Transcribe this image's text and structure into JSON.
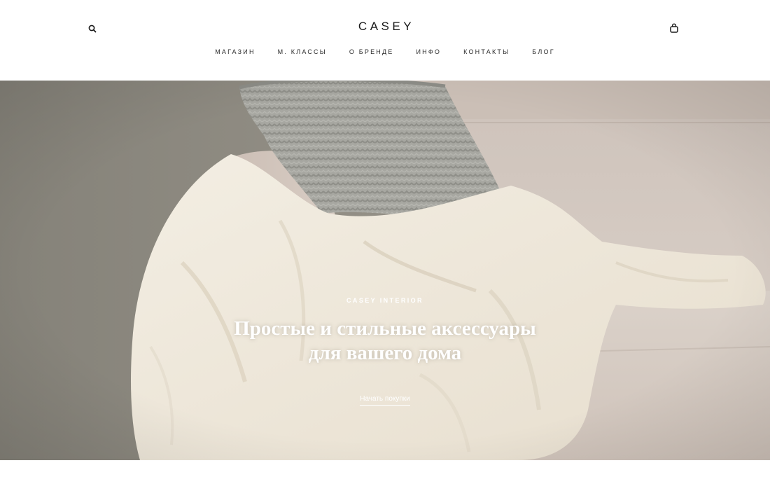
{
  "header": {
    "logo": "CASEY",
    "search_icon": "search-icon",
    "cart_icon": "shopping-bag-icon"
  },
  "nav": {
    "items": [
      {
        "label": "МАГАЗИН"
      },
      {
        "label": "М. КЛАССЫ"
      },
      {
        "label": "О БРЕНДЕ"
      },
      {
        "label": "ИНФО"
      },
      {
        "label": "КОНТАКТЫ"
      },
      {
        "label": "БЛОГ"
      }
    ]
  },
  "hero": {
    "eyebrow": "CASEY INTERIOR",
    "title_line1": "Простые и стильные аксессуары",
    "title_line2": "для вашего дома",
    "cta": "Начать покупки",
    "image": "hero-image"
  },
  "colors": {
    "background": "#ffffff",
    "text": "#1c1c1c",
    "hero_text": "#ffffff",
    "sofa": "#d6cbc3",
    "blanket": "#efe8d9",
    "pillow": "#a8a8a2",
    "wall": "#8e8b82"
  }
}
